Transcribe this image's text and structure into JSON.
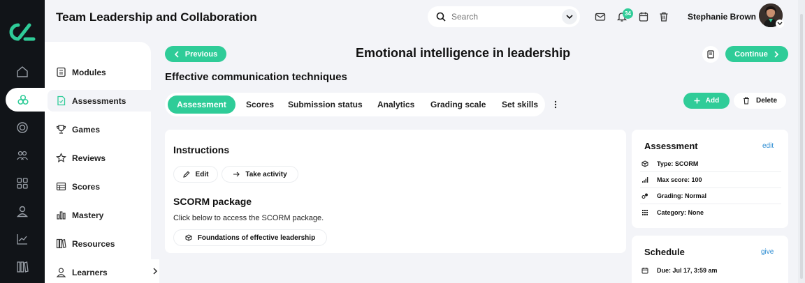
{
  "header": {
    "course_title": "Team Leadership and Collaboration",
    "search": {
      "placeholder": "Search"
    },
    "notifications_count": "34",
    "user_name": "Stephanie Brown"
  },
  "rail": {
    "icons": [
      "home-icon",
      "assessments-icon",
      "target-icon",
      "people-icon",
      "grid-icon",
      "user-icon",
      "chart-icon",
      "books-icon"
    ]
  },
  "subnav": {
    "items": [
      {
        "label": "Modules",
        "icon": "modules-icon"
      },
      {
        "label": "Assessments",
        "icon": "assessment-doc-icon"
      },
      {
        "label": "Games",
        "icon": "trophy-icon"
      },
      {
        "label": "Reviews",
        "icon": "star-icon"
      },
      {
        "label": "Scores",
        "icon": "table-icon"
      },
      {
        "label": "Mastery",
        "icon": "bars-icon"
      },
      {
        "label": "Resources",
        "icon": "books-icon"
      },
      {
        "label": "Learners",
        "icon": "user-icon"
      }
    ],
    "active": "Assessments"
  },
  "main": {
    "previous_label": "Previous",
    "continue_label": "Continue",
    "page_title": "Emotional intelligence in leadership",
    "subtitle": "Effective communication techniques",
    "tabs": [
      "Assessment",
      "Scores",
      "Submission status",
      "Analytics",
      "Grading scale",
      "Set skills"
    ],
    "active_tab": "Assessment",
    "add_label": "Add",
    "delete_label": "Delete",
    "instructions": {
      "heading": "Instructions",
      "edit_label": "Edit",
      "take_activity_label": "Take activity"
    },
    "scorm": {
      "heading": "SCORM package",
      "description": "Click below to access the SCORM package.",
      "package_label": "Foundations of effective leadership"
    }
  },
  "sidebar": {
    "assessment": {
      "heading": "Assessment",
      "edit_link": "edit",
      "rows": [
        {
          "icon": "cube-icon",
          "text": "Type: SCORM"
        },
        {
          "icon": "signal-icon",
          "text": "Max score: 100"
        },
        {
          "icon": "grading-icon",
          "text": "Grading: Normal"
        },
        {
          "icon": "category-grid-icon",
          "text": "Category: None"
        }
      ]
    },
    "schedule": {
      "heading": "Schedule",
      "give_link": "give",
      "rows": [
        {
          "icon": "calendar-icon",
          "text": "Due: Jul 17, 3:59 am"
        }
      ]
    }
  },
  "colors": {
    "accent": "#2fcc98",
    "rail_bg": "#111418",
    "page_bg": "#f3f4f8",
    "link": "#2a8bd2"
  }
}
